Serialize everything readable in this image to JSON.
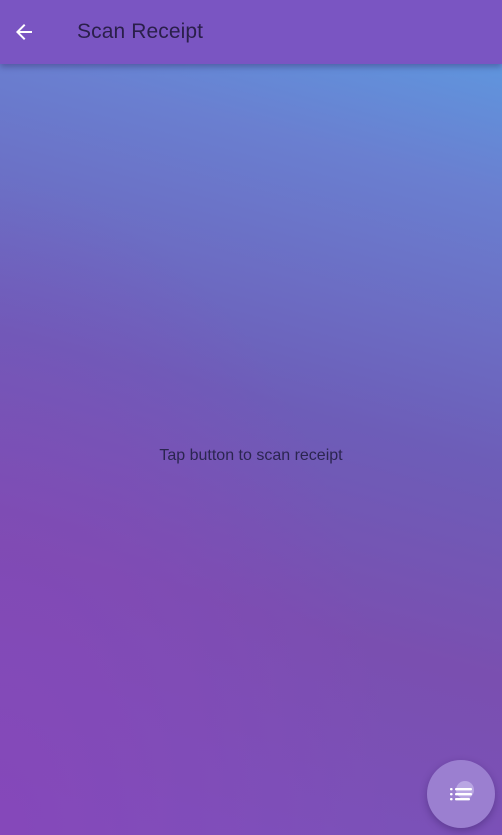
{
  "app_bar": {
    "title": "Scan Receipt",
    "back_icon": "arrow-back-icon",
    "background_color": "#7a55c2"
  },
  "main": {
    "message": "Tap button to scan receipt"
  },
  "fab": {
    "icon": "list-icon",
    "background_color": "#9b7fd0"
  }
}
